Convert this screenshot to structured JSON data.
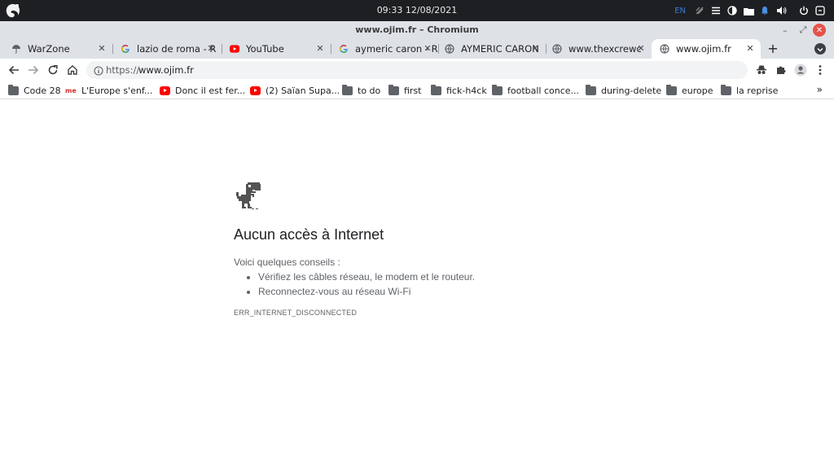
{
  "system": {
    "clock": "09:33 12/08/2021",
    "language": "EN"
  },
  "window": {
    "title": "www.ojim.fr – Chromium",
    "minimize_label": "–",
    "maximize_label": "⤢",
    "close_label": "✕"
  },
  "tabs": [
    {
      "label": "WarZone",
      "icon": "umbrella-icon"
    },
    {
      "label": "lazio de roma - R",
      "icon": "google-icon"
    },
    {
      "label": "YouTube",
      "icon": "youtube-icon"
    },
    {
      "label": "aymeric caron - R",
      "icon": "google-icon"
    },
    {
      "label": "AYMERIC CARON",
      "icon": "globe-icon"
    },
    {
      "label": "www.thexcrewc",
      "icon": "globe-icon"
    },
    {
      "label": "www.ojim.fr",
      "icon": "globe-icon",
      "active": true
    }
  ],
  "tab_close_label": "✕",
  "new_tab_label": "+",
  "omnibox": {
    "scheme": "https://",
    "host": "www.ojim.fr"
  },
  "bookmarks": [
    {
      "label": "Code 28",
      "icon": "folder-icon"
    },
    {
      "label": "L'Europe s'enf...",
      "icon": "me-icon"
    },
    {
      "label": "Donc il est fer...",
      "icon": "youtube-icon"
    },
    {
      "label": "(2) Saïan Supa...",
      "icon": "youtube-icon"
    },
    {
      "label": "to do",
      "icon": "folder-icon"
    },
    {
      "label": "first",
      "icon": "folder-icon"
    },
    {
      "label": "fick-h4ck",
      "icon": "folder-icon"
    },
    {
      "label": "football conce...",
      "icon": "folder-icon"
    },
    {
      "label": "during-delete",
      "icon": "folder-icon"
    },
    {
      "label": "europe",
      "icon": "folder-icon"
    },
    {
      "label": "la reprise",
      "icon": "folder-icon"
    }
  ],
  "bookmarks_more": "»",
  "me_icon_text": "me",
  "error": {
    "title": "Aucun accès à Internet",
    "subtitle": "Voici quelques conseils :",
    "tips": [
      "Vérifiez les câbles réseau, le modem et le routeur.",
      "Reconnectez-vous au réseau Wi-Fi"
    ],
    "code": "ERR_INTERNET_DISCONNECTED"
  },
  "colors": {
    "topbar": "#1e1f22",
    "chrome_frame": "#dee1e6",
    "omnibox_bg": "#f1f3f4",
    "text_secondary": "#5f6368",
    "close_button": "#e5534b",
    "lang_accent": "#3b7bd6"
  }
}
